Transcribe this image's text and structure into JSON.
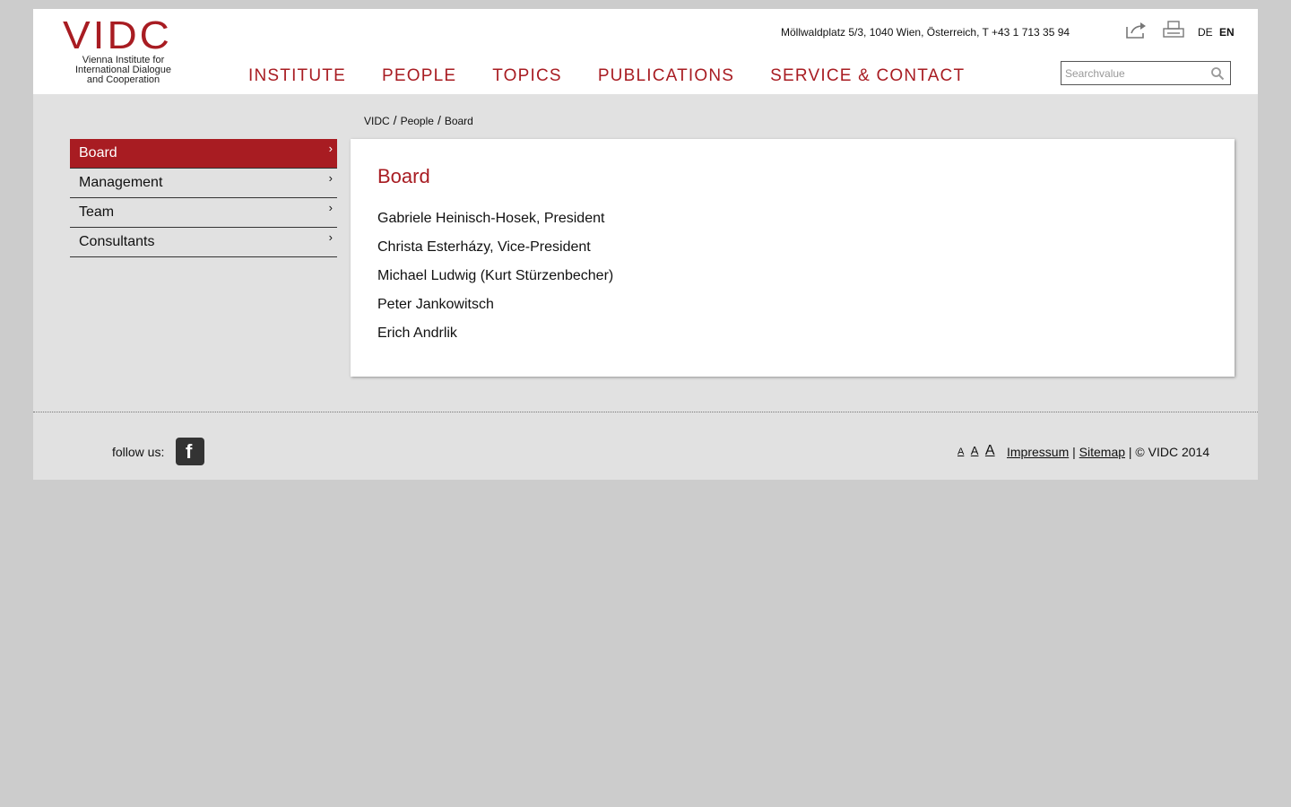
{
  "header": {
    "logo": {
      "mark": "VIDC",
      "line1": "Vienna Institute for",
      "line2": "International Dialogue",
      "line3": "and Cooperation"
    },
    "address": "Möllwaldplatz 5/3, 1040 Wien, Österreich, T +43 1 713 35 94",
    "languages": [
      {
        "label": "DE",
        "active": false
      },
      {
        "label": "EN",
        "active": true
      }
    ],
    "nav": [
      "INSTITUTE",
      "PEOPLE",
      "TOPICS",
      "PUBLICATIONS",
      "SERVICE & CONTACT"
    ],
    "search": {
      "placeholder": "Searchvalue",
      "value": ""
    }
  },
  "breadcrumb": [
    "VIDC",
    "People",
    "Board"
  ],
  "sidebar": {
    "items": [
      {
        "label": "Board",
        "active": true
      },
      {
        "label": "Management",
        "active": false
      },
      {
        "label": "Team",
        "active": false
      },
      {
        "label": "Consultants",
        "active": false
      }
    ]
  },
  "content": {
    "title": "Board",
    "members": [
      "Gabriele Heinisch-Hosek,  President",
      "Christa Esterházy, Vice-President",
      "Michael Ludwig (Kurt Stürzenbecher)",
      "Peter Jankowitsch",
      "Erich Andrlik"
    ]
  },
  "footer": {
    "follow_label": "follow us:",
    "facebook_glyph": "f",
    "font_sizes": [
      "A",
      "A",
      "A"
    ],
    "impressum": "Impressum",
    "sitemap": "Sitemap",
    "sep": "|",
    "copyright": "| © VIDC 2014"
  },
  "colors": {
    "accent": "#a81c22",
    "background": "#cccccc",
    "panel": "#e1e1e1"
  }
}
